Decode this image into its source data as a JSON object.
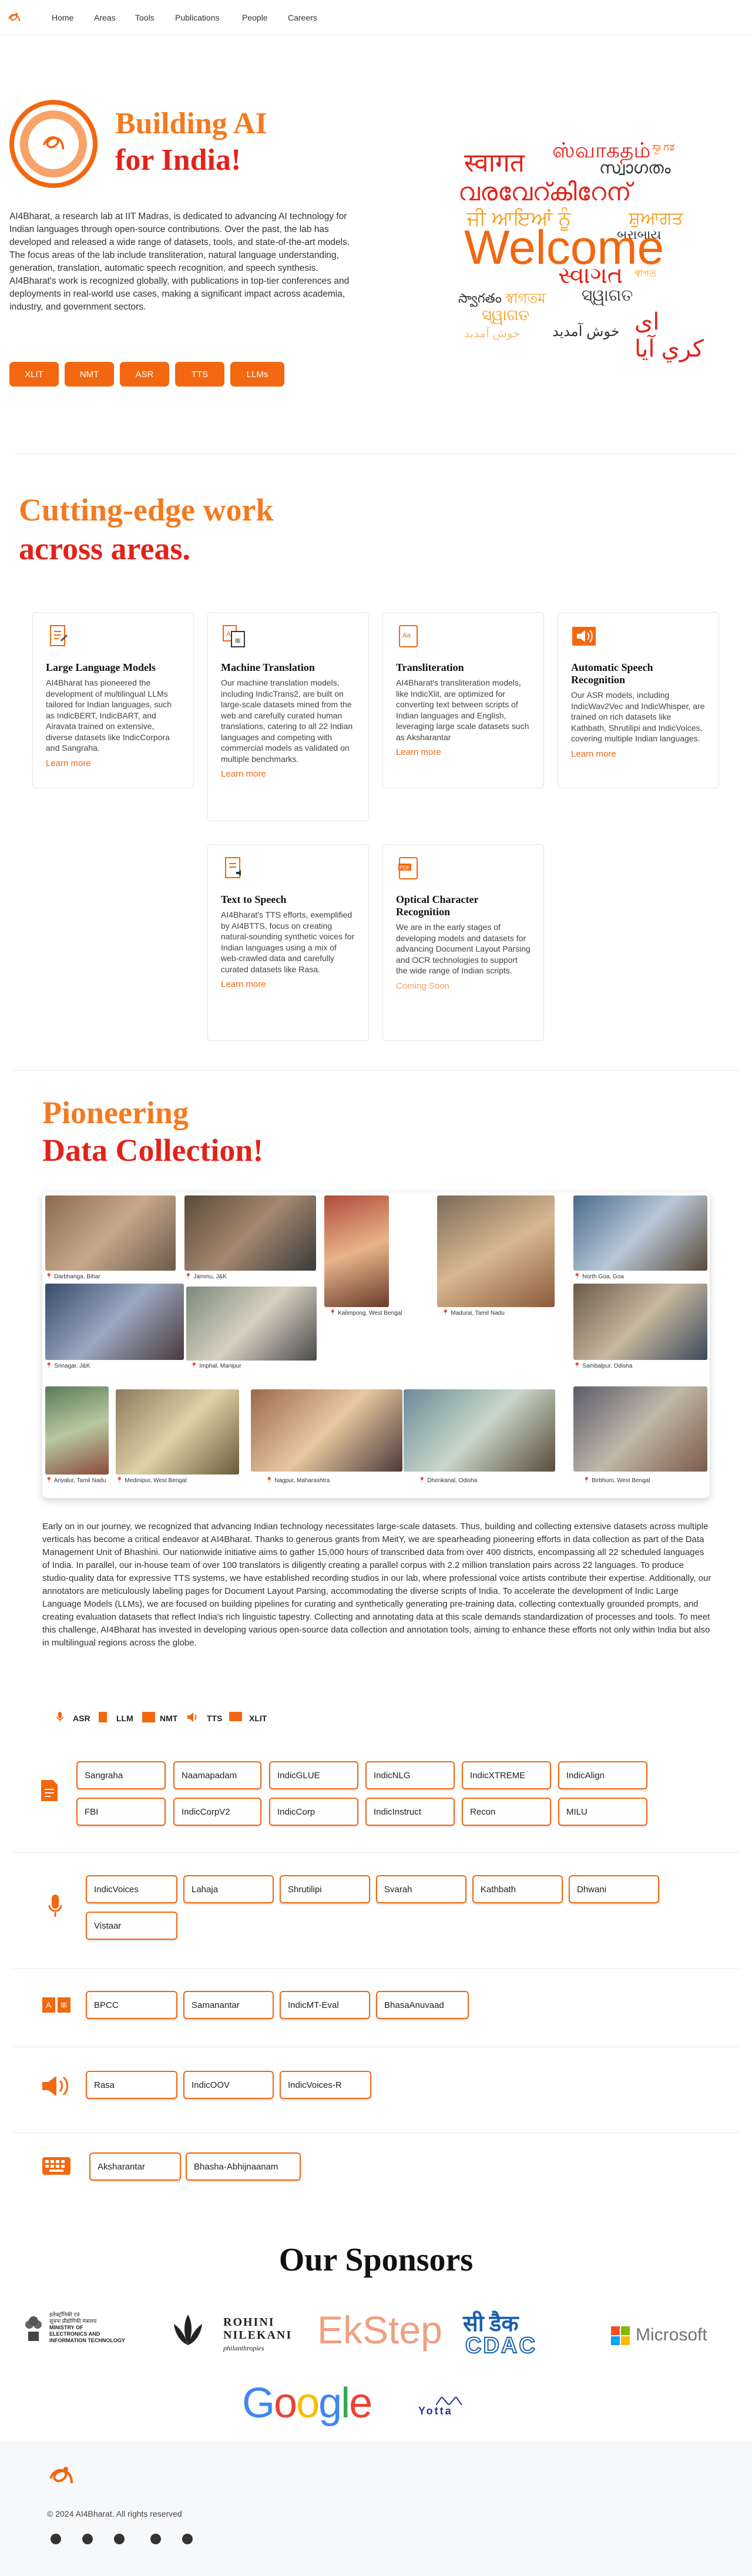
{
  "nav": {
    "items": [
      "Home",
      "Areas",
      "Tools",
      "Publications",
      "People",
      "Careers"
    ]
  },
  "hero": {
    "title_line1": "Building AI",
    "title_line2": "for India!",
    "description": "AI4Bharat, a research lab at IIT Madras, is dedicated to advancing AI technology for Indian languages through open-source contributions. Over the past, the lab has developed and released a wide range of datasets, tools, and state-of-the-art models. The focus areas of the lab include transliteration, natural language understanding, generation, translation, automatic speech recognition, and speech synthesis. AI4Bharat's work is recognized globally, with publications in top-tier conferences and deployments in real-world use cases, making a significant impact across academia, industry, and government sectors.",
    "buttons": [
      "XLIT",
      "NMT",
      "ASR",
      "TTS",
      "LLMs"
    ],
    "welcome_words": [
      "स्वागत",
      "ஸ்வாகதம்",
      "ಸ್ವಾಗತ",
      "സ്വാഗതം",
      "വരവേറ്കിറേന്",
      "ਜੀ ਆਇਆਂ ਨੂੰ",
      "ਸ਼ੁਆਗਤ",
      "Welcome",
      "બરાબાય",
      "સ્વાગત",
      "স্বাগত",
      "স্বাগতম",
      "ସ୍ୱାଗତ",
      "ସ୍ୱାଗତ",
      "స్వాగతం",
      "خوش آمدید",
      "خوش آمديد",
      "ای کري آیا"
    ]
  },
  "areas": {
    "title_line1": "Cutting-edge work",
    "title_line2": "across areas.",
    "cards": [
      {
        "title": "Large Language Models",
        "text": "AI4Bharat has pioneered the development of multilingual LLMs tailored for Indian languages, such as IndicBERT, IndicBART, and Airavata trained on extensive, diverse datasets like IndicCorpora and Sangraha.",
        "link": "Learn more"
      },
      {
        "title": "Machine Translation",
        "text": "Our machine translation models, including IndicTrans2, are built on large-scale datasets mined from the web and carefully curated human translations, catering to all 22 Indian languages and competing with commercial models as validated on multiple benchmarks.",
        "link": "Learn more"
      },
      {
        "title": "Transliteration",
        "text": "AI4Bharat's transliteration models, like IndicXlit, are optimized for converting text between scripts of Indian languages and English, leveraging large scale datasets such as Aksharantar",
        "link": "Learn more"
      },
      {
        "title": "Automatic Speech Recognition",
        "text": "Our ASR models, including IndicWav2Vec and IndicWhisper, are trained on rich datasets like Kathbath, Shrutilipi and IndicVoices, covering multiple Indian languages.",
        "link": "Learn more"
      },
      {
        "title": "Text to Speech",
        "text": "AI4Bharat's TTS efforts, exemplified by AI4BTTS, focus on creating natural-sounding synthetic voices for Indian languages using a mix of web-crawled data and carefully curated datasets like Rasa.",
        "link": "Learn more"
      },
      {
        "title": "Optical Character Recognition",
        "text": "We are in the early stages of developing models and datasets for advancing Document Layout Parsing and OCR technologies to support the wide range of Indian scripts.",
        "link": "Coming Soon"
      }
    ]
  },
  "data_collection": {
    "title_line1": "Pioneering",
    "title_line2": "Data Collection!",
    "locations": [
      "Darbhanga, Bihar",
      "Jammu, J&K",
      "Kalimpong, West Bengal",
      "Madurai, Tamil Nadu",
      "North Goa, Goa",
      "Srinagar, J&K",
      "Imphal, Manipur",
      "Sambalpur, Odisha",
      "Ariyalur, Tamil Nadu",
      "Medinipur, West Bengal",
      "Nagpur, Maharashtra",
      "Dhenkanal, Odisha",
      "Birbhum, West Bengal"
    ],
    "description": "Early on in our journey, we recognized that advancing Indian technology necessitates large-scale datasets. Thus, building and collecting extensive datasets across multiple verticals has become a critical endeavor at AI4Bharat. Thanks to generous grants from MeitY, we are spearheading pioneering efforts in data collection as part of the Data Management Unit of Bhashini. Our nationwide initiative aims to gather 15,000 hours of transcribed data from over 400 districts, encompassing all 22 scheduled languages of India. In parallel, our in-house team of over 100 translators is diligently creating a parallel corpus with 2.2 million translation pairs across 22 languages. To produce studio-quality data for expressive TTS systems, we have established recording studios in our lab, where professional voice artists contribute their expertise. Additionally, our annotators are meticulously labeling pages for Document Layout Parsing, accommodating the diverse scripts of India. To accelerate the development of Indic Large Language Models (LLMs), we are focused on building pipelines for curating and synthetically generating pre-training data, collecting contextually grounded prompts, and creating evaluation datasets that reflect India's rich linguistic tapestry. Collecting and annotating data at this scale demands standardization of processes and tools. To meet this challenge, AI4Bharat has invested in developing various open-source data collection and annotation tools, aiming to enhance these efforts not only within India but also in multilingual regions across the globe."
  },
  "legend": [
    "ASR",
    "LLM",
    "NMT",
    "TTS",
    "XLIT"
  ],
  "datasets": {
    "llm": [
      "Sangraha",
      "Naamapadam",
      "IndicGLUE",
      "IndicNLG",
      "IndicXTREME",
      "IndicAlign",
      "FBI",
      "IndicCorpV2",
      "IndicCorp",
      "IndicInstruct",
      "Recon",
      "MILU"
    ],
    "asr": [
      "IndicVoices",
      "Lahaja",
      "Shrutilipi",
      "Svarah",
      "Kathbath",
      "Dhwani",
      "Vistaar"
    ],
    "nmt": [
      "BPCC",
      "Samanantar",
      "IndicMT-Eval",
      "BhasaAnuvaad"
    ],
    "tts": [
      "Rasa",
      "IndicOOV",
      "IndicVoices-R"
    ],
    "xlit": [
      "Aksharantar",
      "Bhasha-Abhijnaanam"
    ]
  },
  "sponsors": {
    "title": "Our Sponsors",
    "names": [
      "Ministry of Electronics and Information Technology",
      "Rohini Nilekani Philanthropies",
      "EkStep",
      "C-DAC",
      "Microsoft",
      "Google",
      "Yotta"
    ],
    "meity_lines": [
      "इलेक्ट्रॉनिकी एवं",
      "सूचना प्रौद्योगिकी मंत्रालय",
      "MINISTRY OF",
      "ELECTRONICS AND",
      "INFORMATION TECHNOLOGY"
    ],
    "rohini_lines": [
      "ROHINI",
      "NILEKANI",
      "philanthropies"
    ],
    "cdac_lines": [
      "सी डैक",
      "CDAC"
    ]
  },
  "footer": {
    "copyright": "© 2024 AI4Bharat. All rights reserved"
  },
  "colors": {
    "accent": "#f2670f",
    "red": "#e2231a"
  }
}
